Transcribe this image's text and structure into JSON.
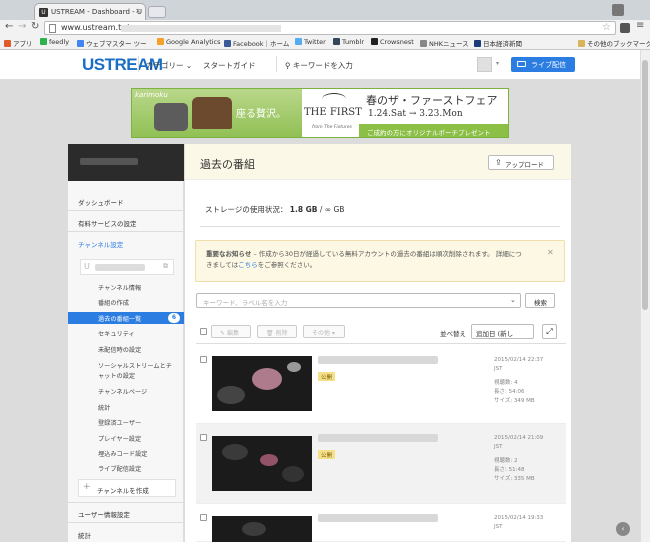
{
  "browser": {
    "tab_title": "USTREAM - Dashboard - U",
    "tab_favicon": "U",
    "url": "www.ustream.tv/",
    "bookmarks": [
      {
        "label": "アプリ",
        "color": "#e25c2b"
      },
      {
        "label": "feedly",
        "color": "#2bb24c"
      },
      {
        "label": "ウェブマスター ツー",
        "color": "#4285f4"
      },
      {
        "label": "Google Analytics",
        "color": "#f4a12b"
      },
      {
        "label": "Facebook｜ホーム",
        "color": "#3b5998"
      },
      {
        "label": "Twitter",
        "color": "#55acee"
      },
      {
        "label": "Tumblr",
        "color": "#36465d"
      },
      {
        "label": "Crowsnest",
        "color": "#222222"
      },
      {
        "label": "NHKニュース",
        "color": "#888888"
      },
      {
        "label": "日本経済新聞",
        "color": "#1a3c7a"
      }
    ],
    "other_bookmarks": "その他のブックマーク"
  },
  "header": {
    "logo": "USTREAM",
    "nav_category": "カテゴリー",
    "nav_category_caret": "⌄",
    "nav_start_guide": "スタートガイド",
    "search_placeholder": "キーワードを入力",
    "live_button": "ライブ配信",
    "accent": "#2b7de1"
  },
  "ad": {
    "brand": "karimoku",
    "copy": "座る贅沢。",
    "logo_text": "THE FIRST",
    "logo_sub": "from The Fixtures",
    "headline": "春のザ・ファーストフェア",
    "dates": "1.24.Sat → 3.23.Mon",
    "cta": "ご成約の方にオリジナルポーチプレゼント"
  },
  "sidebar": {
    "dashboard": "ダッシュボード",
    "paid_services": "有料サービスの設定",
    "channel_settings": "チャンネル設定",
    "channel_icon": "U",
    "sub_items": [
      "チャンネル情報",
      "番組の作成",
      "過去の番組一覧",
      "セキュリティ",
      "未配信時の設定",
      "ソーシャルストリームとチ",
      "ャットの設定",
      "チャンネルページ",
      "統計",
      "登録済ユーザー",
      "プレイヤー設定",
      "埋込みコード設定",
      "ライブ配信設定"
    ],
    "active_badge": "6",
    "create_channel": "チャンネルを作成",
    "user_info": "ユーザー情報設定",
    "stats": "統計"
  },
  "main": {
    "title": "過去の番組",
    "upload_button": "アップロード",
    "storage_label": "ストレージの使用状況：",
    "storage_value": "1.8 GB",
    "storage_total": "/ ∞ GB",
    "notice_bold": "重要なお知らせ",
    "notice_text": " – 作成から30日が経過している無料アカウントの過去の番組は順次削除されます。 詳細につきましては",
    "notice_link": "こちら",
    "notice_tail": "をご参照ください。",
    "search_placeholder": "キーワード、ラベル名を入力",
    "search_button": "検索",
    "toolbar": {
      "edit": "編集",
      "delete": "削除",
      "other": "その他"
    },
    "sort_label": "並べ替え",
    "sort_value": "追加日 (新し",
    "rows": [
      {
        "date": "2015/02/14 22:37",
        "tz": "JST",
        "views": "視聴数: 4",
        "length": "長さ: 54:06",
        "size": "サイズ: 349 MB",
        "status": "公開"
      },
      {
        "date": "2015/02/14 21:09",
        "tz": "JST",
        "views": "視聴数: 2",
        "length": "長さ: 51:48",
        "size": "サイズ: 335 MB",
        "status": "公開"
      },
      {
        "date": "2015/02/14 19:33",
        "tz": "JST",
        "views": "",
        "length": "",
        "size": "",
        "status": ""
      }
    ]
  }
}
